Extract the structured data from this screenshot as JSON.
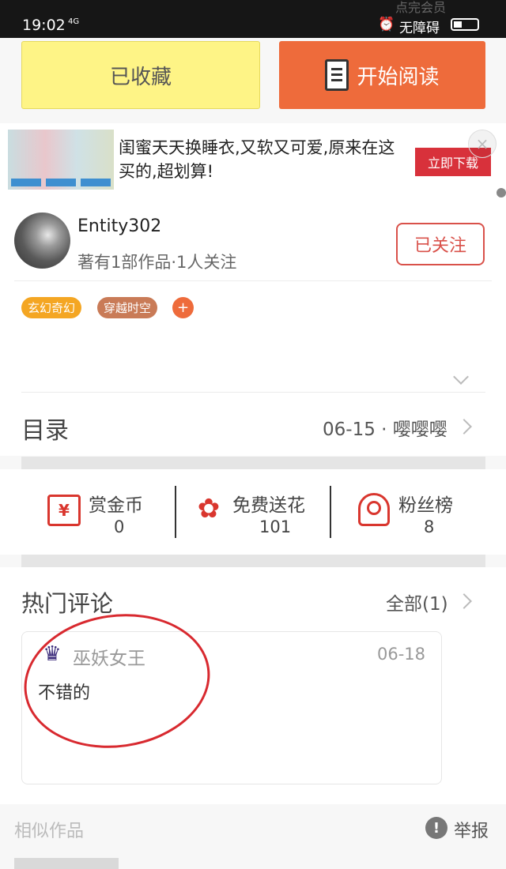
{
  "status_bar": {
    "time": "19:02",
    "network": "4G",
    "accessibility": "无障碍",
    "ghost_text": "点完会员"
  },
  "actions": {
    "favorited_label": "已收藏",
    "start_reading_label": "开始阅读"
  },
  "ad": {
    "text": "闺蜜天天换睡衣,又软又可爱,原来在这买的,超划算!",
    "download_label": "立即下载",
    "close_symbol": "×"
  },
  "author": {
    "name": "Entity302",
    "meta": "著有1部作品·1人关注",
    "follow_label": "已关注",
    "tags": [
      "玄幻奇幻",
      "穿越时空"
    ],
    "add_tag_symbol": "+"
  },
  "toc": {
    "title": "目录",
    "latest": "06-15 · 嘤嘤嘤"
  },
  "stats": [
    {
      "label": "赏金币",
      "value": "0",
      "icon": "money-envelope-icon"
    },
    {
      "label": "免费送花",
      "value": "101",
      "icon": "flower-icon"
    },
    {
      "label": "粉丝榜",
      "value": "8",
      "icon": "medal-icon"
    }
  ],
  "comments": {
    "title": "热门评论",
    "all_label": "全部(1)",
    "items": [
      {
        "user": "巫妖女王",
        "date": "06-18",
        "text": "不错的"
      }
    ]
  },
  "footer": {
    "similar_title": "相似作品",
    "report_label": "举报",
    "report_icon_symbol": "!"
  },
  "colors": {
    "favorite_bg": "#fef486",
    "read_bg": "#ee6b3b",
    "follow_red": "#d9514a",
    "annotation_red": "#d8292f"
  }
}
